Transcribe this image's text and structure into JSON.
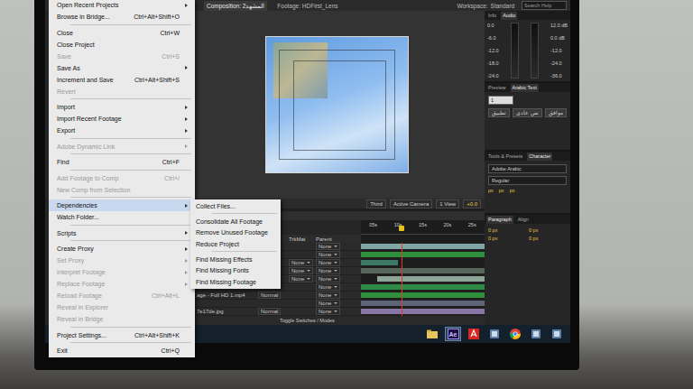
{
  "header": {
    "tabs": [
      {
        "label": "Composition: 2المشهد",
        "selected": true
      },
      {
        "label": "Footage: HDFirst_Lens",
        "selected": false
      }
    ],
    "workspace_label": "Workspace:",
    "workspace_value": "Standard",
    "search_placeholder": "Search Help"
  },
  "file_menu": {
    "groups": [
      [
        {
          "label": "Open Recent Projects",
          "submenu": true,
          "disabled": false,
          "selected": false
        },
        {
          "label": "Browse in Bridge...",
          "shortcut": "Ctrl+Alt+Shift+O",
          "submenu": false,
          "disabled": false,
          "selected": false
        }
      ],
      [
        {
          "label": "Close",
          "shortcut": "Ctrl+W",
          "submenu": false,
          "disabled": false,
          "selected": false
        },
        {
          "label": "Close Project",
          "submenu": false,
          "disabled": false,
          "selected": false
        },
        {
          "label": "Save",
          "shortcut": "Ctrl+S",
          "submenu": false,
          "disabled": true,
          "selected": false
        },
        {
          "label": "Save As",
          "submenu": true,
          "disabled": false,
          "selected": false
        },
        {
          "label": "Increment and Save",
          "shortcut": "Ctrl+Alt+Shift+S",
          "submenu": false,
          "disabled": false,
          "selected": false
        },
        {
          "label": "Revert",
          "submenu": false,
          "disabled": true,
          "selected": false
        }
      ],
      [
        {
          "label": "Import",
          "submenu": true,
          "disabled": false,
          "selected": false
        },
        {
          "label": "Import Recent Footage",
          "submenu": true,
          "disabled": false,
          "selected": false
        },
        {
          "label": "Export",
          "submenu": true,
          "disabled": false,
          "selected": false
        }
      ],
      [
        {
          "label": "Adobe Dynamic Link",
          "submenu": true,
          "disabled": true,
          "selected": false
        }
      ],
      [
        {
          "label": "Find",
          "shortcut": "Ctrl+F",
          "submenu": false,
          "disabled": false,
          "selected": false
        }
      ],
      [
        {
          "label": "Add Footage to Comp",
          "shortcut": "Ctrl+/",
          "submenu": false,
          "disabled": true,
          "selected": false
        },
        {
          "label": "New Comp from Selection",
          "submenu": false,
          "disabled": true,
          "selected": false
        }
      ],
      [
        {
          "label": "Dependencies",
          "submenu": true,
          "disabled": false,
          "selected": true
        },
        {
          "label": "Watch Folder...",
          "submenu": false,
          "disabled": false,
          "selected": false
        }
      ],
      [
        {
          "label": "Scripts",
          "submenu": true,
          "disabled": false,
          "selected": false
        }
      ],
      [
        {
          "label": "Create Proxy",
          "submenu": true,
          "disabled": false,
          "selected": false
        },
        {
          "label": "Set Proxy",
          "submenu": true,
          "disabled": true,
          "selected": false
        },
        {
          "label": "Interpret Footage",
          "submenu": true,
          "disabled": true,
          "selected": false
        },
        {
          "label": "Replace Footage",
          "submenu": true,
          "disabled": true,
          "selected": false
        },
        {
          "label": "Reload Footage",
          "shortcut": "Ctrl+Alt+L",
          "submenu": false,
          "disabled": true,
          "selected": false
        },
        {
          "label": "Reveal in Explorer",
          "submenu": false,
          "disabled": true,
          "selected": false
        },
        {
          "label": "Reveal in Bridge",
          "submenu": false,
          "disabled": true,
          "selected": false
        }
      ],
      [
        {
          "label": "Project Settings...",
          "shortcut": "Ctrl+Alt+Shift+K",
          "submenu": false,
          "disabled": false,
          "selected": false
        }
      ],
      [
        {
          "label": "Exit",
          "shortcut": "Ctrl+Q",
          "submenu": false,
          "disabled": false,
          "selected": false
        }
      ]
    ]
  },
  "dependencies_menu": {
    "groups": [
      [
        {
          "label": "Collect Files..."
        }
      ],
      [
        {
          "label": "Consolidate All Footage"
        },
        {
          "label": "Remove Unused Footage"
        },
        {
          "label": "Reduce Project"
        }
      ],
      [
        {
          "label": "Find Missing Effects"
        },
        {
          "label": "Find Missing Fonts"
        },
        {
          "label": "Find Missing Footage"
        }
      ]
    ]
  },
  "viewer": {
    "controls": [
      "Third",
      "Active Camera",
      "1 View",
      "+0.0"
    ]
  },
  "timeline": {
    "columns": [
      "TrkMat",
      "Parent"
    ],
    "ruler": [
      "05s",
      "10s",
      "15s",
      "20s",
      "25s"
    ],
    "playhead": {
      "level": 0.33
    },
    "rows": [
      {
        "parent": "None",
        "color": "#7fa6a4",
        "start": 0,
        "end": 30
      },
      {
        "parent": "None",
        "color": "#2f8f3c",
        "start": 0,
        "end": 30
      },
      {
        "trkmat": "None",
        "parent": "None",
        "color": "#3c7a66",
        "start": 0,
        "end": 9
      },
      {
        "trkmat": "None",
        "parent": "None",
        "color": "#56665a",
        "start": 0,
        "end": 30
      },
      {
        "trkmat": "None",
        "parent": "None",
        "color": "#8ea497",
        "start": 4,
        "end": 30
      },
      {
        "parent": "None",
        "color": "#2e8a45",
        "start": 0,
        "end": 30
      },
      {
        "name": "age - Full HD 1.mp4",
        "mode": "Normal",
        "parent": "None",
        "color": "#2f8f3c",
        "start": 0,
        "end": 30
      },
      {
        "parent": "None",
        "color": "#5d6478",
        "start": 0,
        "end": 30
      },
      {
        "name": "7e17de.jpg",
        "mode": "Normal",
        "parent": "None",
        "color": "#8876a6",
        "start": 0,
        "end": 30
      }
    ],
    "footer": "Toggle Switches / Modes"
  },
  "audio_panel": {
    "tabs": [
      {
        "label": "Info",
        "selected": false
      },
      {
        "label": "Audio",
        "selected": true
      }
    ],
    "left": [
      "0.0",
      "-6.0",
      "-12.0",
      "-18.0",
      "-24.0"
    ],
    "right": [
      "12.0 dB",
      "0.0 dB",
      "-12.0",
      "-24.0",
      "-36.0"
    ]
  },
  "arabic_panel": {
    "tabs": [
      {
        "label": "Preview",
        "selected": false
      },
      {
        "label": "Arabic Text",
        "selected": true
      }
    ],
    "value": "1",
    "buttons": [
      "تطبيق",
      "نص عادي",
      "موافق"
    ]
  },
  "character_panel": {
    "tabs": [
      {
        "label": "Tools & Presets",
        "selected": false
      },
      {
        "label": "Character",
        "selected": true
      }
    ],
    "font": "Adobe Arabic",
    "style": "Regular",
    "units": [
      "px",
      "px",
      "px"
    ]
  },
  "paragraph_panel": {
    "tabs": [
      {
        "label": "Paragraph",
        "selected": true
      },
      {
        "label": "Align",
        "selected": false
      }
    ],
    "fields": [
      "0 px",
      "0 px",
      "0 px",
      "0 px"
    ]
  },
  "taskbar": {
    "icons": [
      {
        "kind": "folder",
        "selected": false
      },
      {
        "kind": "ae",
        "label": "Ae",
        "selected": true
      },
      {
        "kind": "acrobat",
        "selected": false
      },
      {
        "kind": "app",
        "selected": false
      },
      {
        "kind": "chrome",
        "selected": false
      },
      {
        "kind": "app",
        "selected": false
      },
      {
        "kind": "app",
        "selected": false
      }
    ]
  }
}
